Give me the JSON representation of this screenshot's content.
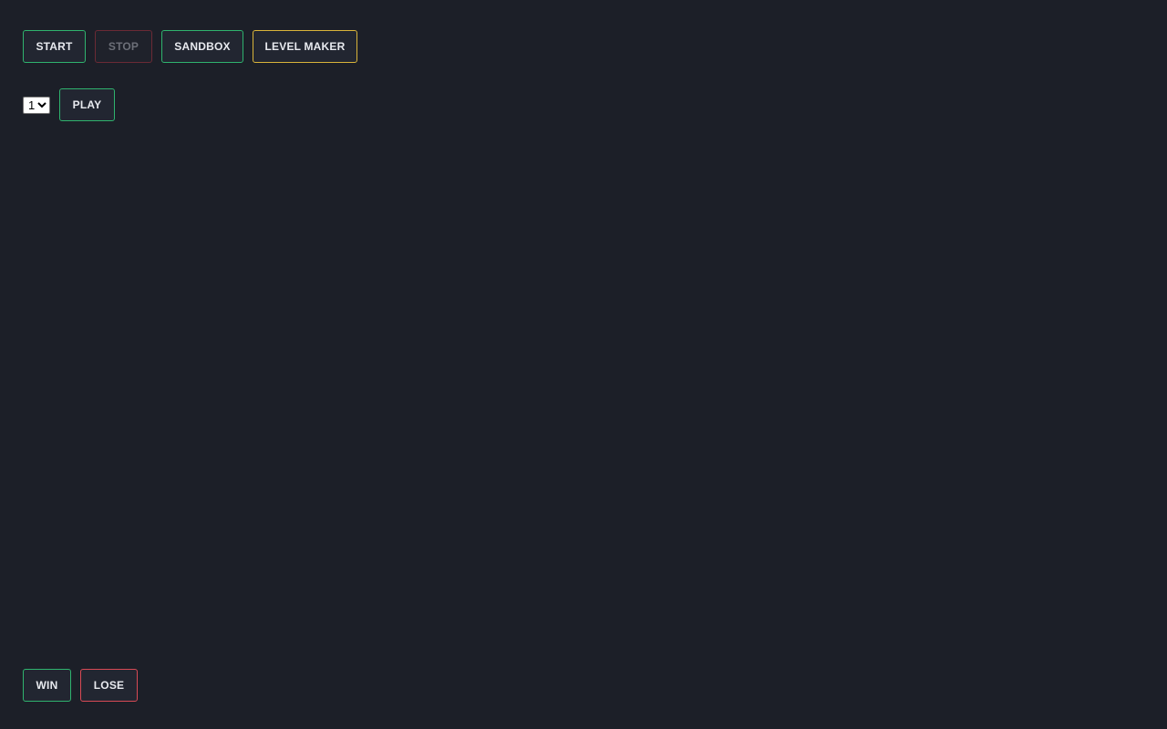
{
  "toolbar": {
    "start_label": "START",
    "stop_label": "STOP",
    "sandbox_label": "SANDBOX",
    "level_maker_label": "LEVEL MAKER"
  },
  "level": {
    "selected": "1",
    "options": [
      "1"
    ],
    "play_label": "PLAY"
  },
  "result": {
    "win_label": "WIN",
    "lose_label": "LOSE"
  },
  "colors": {
    "background": "#1c1f28",
    "green_border": "#2fb36e",
    "red_border": "#d84a55",
    "gold_border": "#d9b43a"
  }
}
